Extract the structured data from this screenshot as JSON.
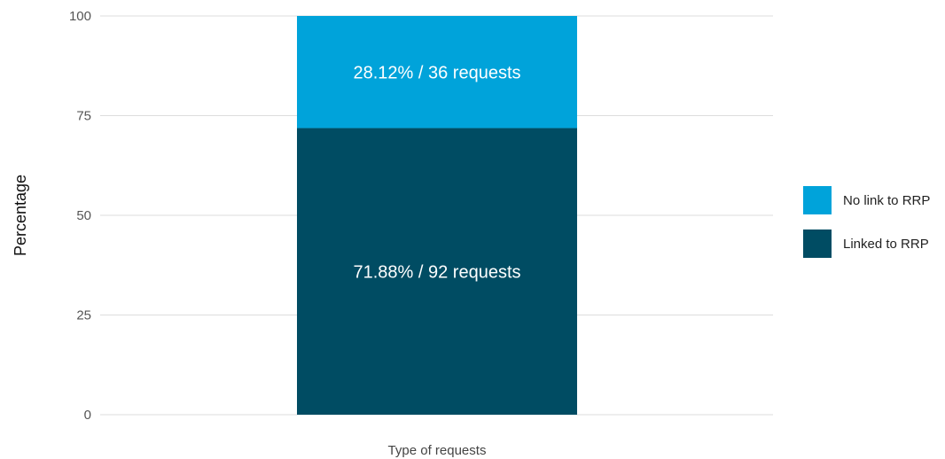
{
  "chart_data": {
    "type": "bar",
    "stacked": true,
    "categories": [
      ""
    ],
    "series": [
      {
        "name": "Linked to RRP",
        "values": [
          71.88
        ],
        "label": "71.88% / 92 requests",
        "color": "#004C63"
      },
      {
        "name": "No link to RRP",
        "values": [
          28.12
        ],
        "label": "28.12% / 36 requests",
        "color": "#00A3DA"
      }
    ],
    "xlabel": "Type of requests",
    "ylabel": "Percentage",
    "ylim": [
      0,
      100
    ],
    "yticks": [
      "0",
      "25",
      "50",
      "75",
      "100"
    ],
    "grid": true,
    "legend_position": "right",
    "legend_order": [
      "No link to RRP",
      "Linked to RRP"
    ]
  }
}
